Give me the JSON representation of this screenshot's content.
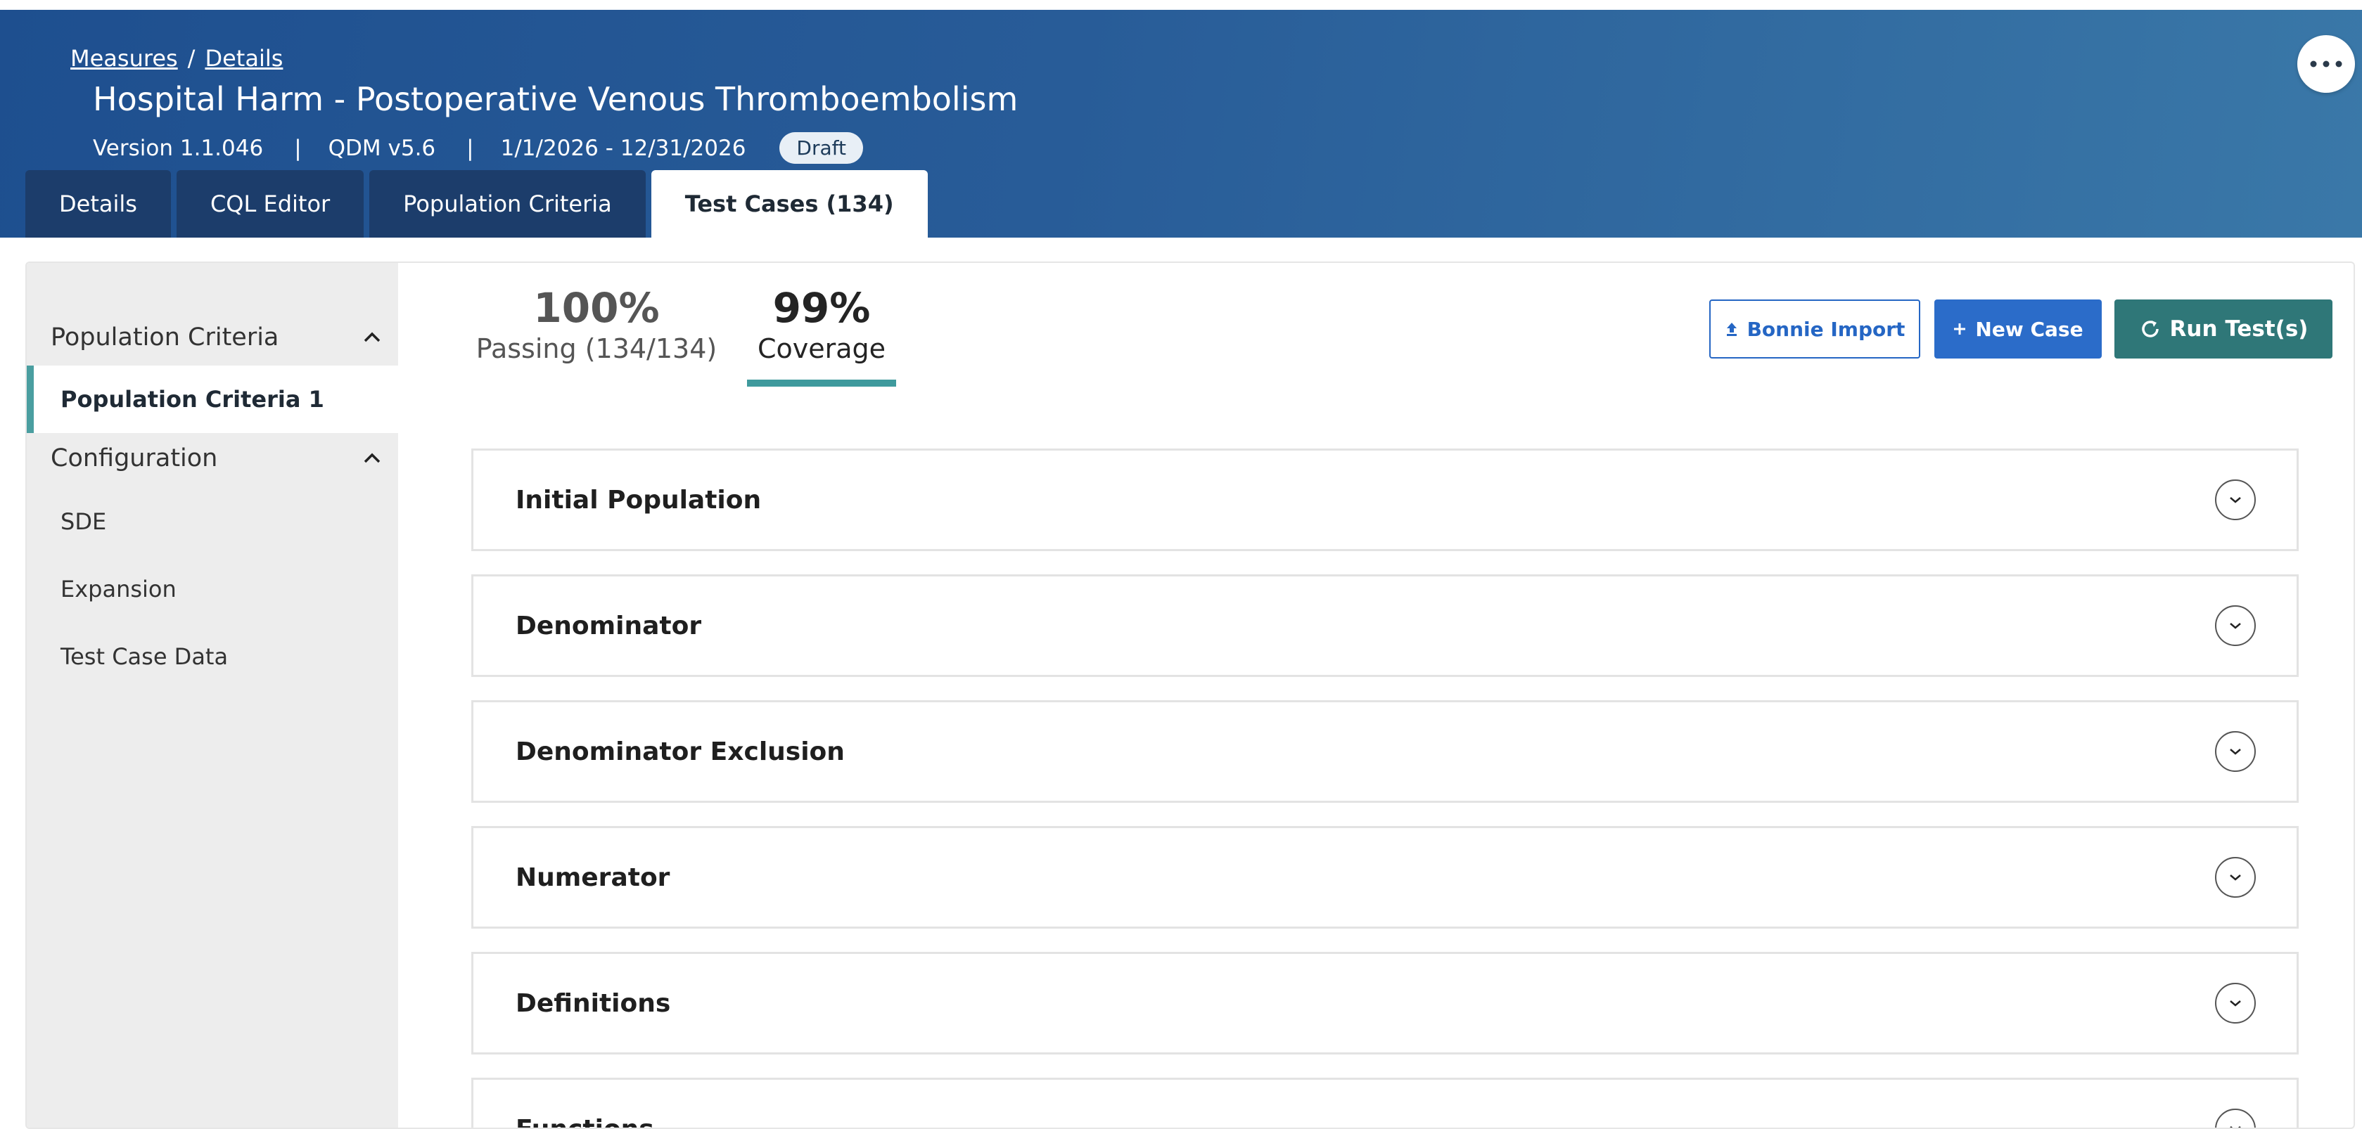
{
  "breadcrumb": {
    "measures": "Measures",
    "sep": "/",
    "details": "Details"
  },
  "measure": {
    "title": "Hospital Harm - Postoperative Venous Thromboembolism",
    "version": "Version 1.1.046",
    "sep": "|",
    "model": "QDM v5.6",
    "period": "1/1/2026 - 12/31/2026",
    "status": "Draft"
  },
  "tabs": [
    {
      "label": "Details"
    },
    {
      "label": "CQL Editor"
    },
    {
      "label": "Population Criteria"
    },
    {
      "label": "Test Cases (134)"
    }
  ],
  "sidebar": {
    "population_criteria": {
      "label": "Population Criteria",
      "items": [
        {
          "label": "Population Criteria 1"
        }
      ]
    },
    "configuration": {
      "label": "Configuration",
      "items": [
        {
          "label": "SDE"
        },
        {
          "label": "Expansion"
        },
        {
          "label": "Test Case Data"
        }
      ]
    }
  },
  "stats": {
    "passing_value": "100%",
    "passing_label": "Passing (134/134)",
    "coverage_value": "99%",
    "coverage_label": "Coverage"
  },
  "buttons": {
    "import": "Bonnie Import",
    "new_case": "New Case",
    "run": "Run Test(s)"
  },
  "accordions": [
    {
      "title": "Initial Population"
    },
    {
      "title": "Denominator"
    },
    {
      "title": "Denominator Exclusion"
    },
    {
      "title": "Numerator"
    },
    {
      "title": "Definitions"
    },
    {
      "title": "Functions"
    }
  ],
  "colors": {
    "header": "#285c98",
    "accent_teal": "#3f9a9d",
    "primary_blue": "#2b6cc9",
    "run_button": "#2f7778"
  },
  "icons": {
    "more": "more-horizontal-icon",
    "collapse": "chevron-up-icon",
    "expand": "chevron-down-icon",
    "upload": "upload-icon",
    "plus": "plus-icon",
    "refresh": "refresh-icon"
  }
}
